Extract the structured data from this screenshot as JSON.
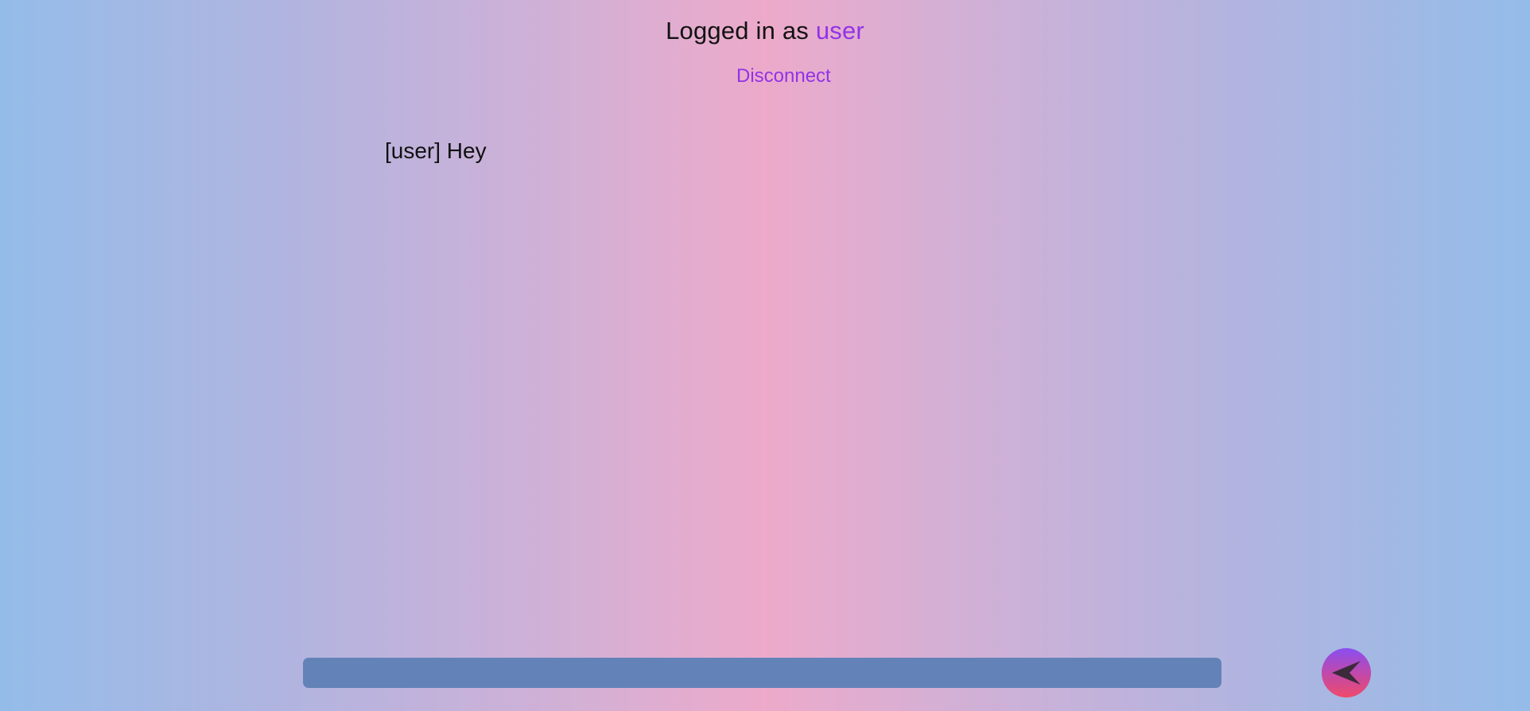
{
  "header": {
    "logged_prefix": "Logged in as ",
    "username": "user",
    "disconnect_label": "Disconnect"
  },
  "messages": [
    {
      "text": "[user] Hey"
    }
  ],
  "composer": {
    "value": "",
    "placeholder": "",
    "send_icon": "send-arrow-icon"
  },
  "colors": {
    "accent": "#9233e6",
    "input_bg": "#6383b8"
  }
}
